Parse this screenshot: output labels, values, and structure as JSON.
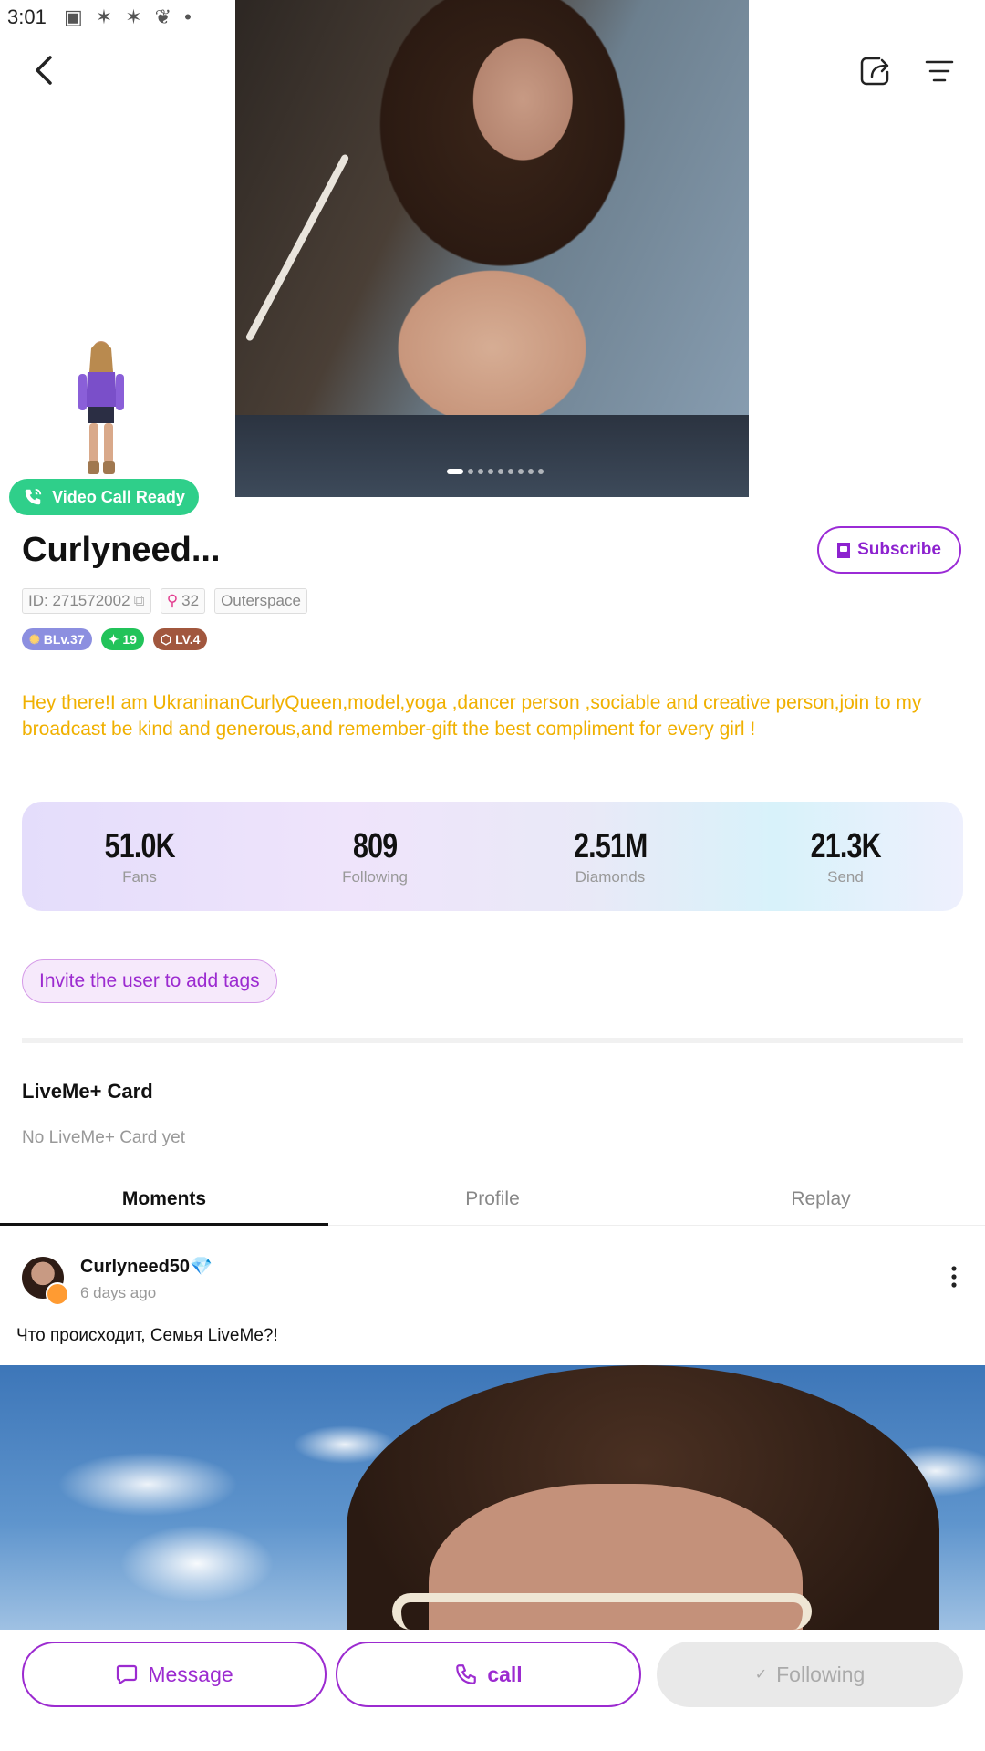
{
  "status_bar": {
    "time": "3:01",
    "icons": [
      "image-icon",
      "pinwheel-icon",
      "pinwheel-icon",
      "squirrel-icon",
      "dot-icon"
    ]
  },
  "hero": {
    "slide_count": 9,
    "active_slide": 0
  },
  "video_call_badge": "Video Call Ready",
  "profile": {
    "name": "Curlyneed...",
    "subscribe_label": "Subscribe",
    "id_chip": "ID: 271572002",
    "key_count": "32",
    "location": "Outerspace",
    "badges": {
      "blv": "BLv.37",
      "level_green": "19",
      "lv": "LV.4"
    },
    "bio": "Hey there!I am UkraninanCurlyQueen,model,yoga ,dancer person ,sociable and creative person,join to my broadcast be kind and generous,and remember-gift the best compliment for every girl !"
  },
  "stats": [
    {
      "value": "51.0K",
      "label": "Fans"
    },
    {
      "value": "809",
      "label": "Following"
    },
    {
      "value": "2.51M",
      "label": "Diamonds"
    },
    {
      "value": "21.3K",
      "label": "Send"
    }
  ],
  "tags_button": "Invite the user to add tags",
  "card": {
    "title": "LiveMe+ Card",
    "empty_text": "No LiveMe+ Card yet"
  },
  "tabs": [
    {
      "label": "Moments",
      "active": true
    },
    {
      "label": "Profile",
      "active": false
    },
    {
      "label": "Replay",
      "active": false
    }
  ],
  "post": {
    "author": "Curlyneed50",
    "author_badge": "💎",
    "time": "6 days ago",
    "text": "Что происходит, Семья LiveMe?!"
  },
  "bottom_bar": {
    "message": "Message",
    "call": "call",
    "following": "Following"
  },
  "colors": {
    "accent": "#9c2bd0",
    "bio": "#f0b000",
    "video_call": "#2fcf8a"
  }
}
